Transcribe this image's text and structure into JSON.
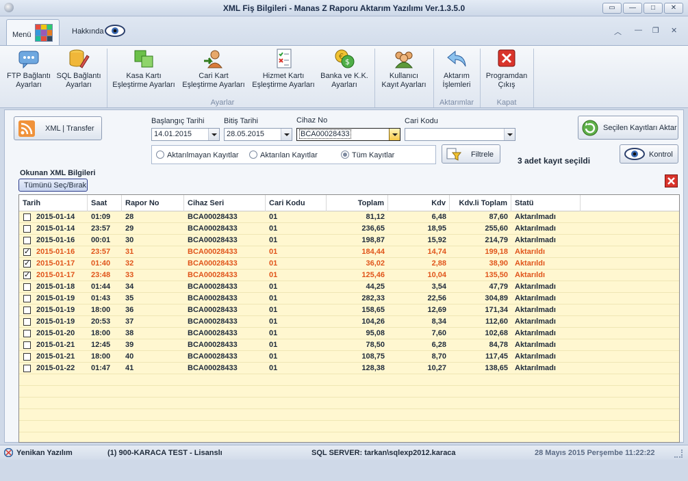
{
  "window": {
    "title": "XML Fiş Bilgileri - Manas Z Raporu Aktarım Yazılımı Ver.1.3.5.0"
  },
  "tabs": {
    "menu": "Menü",
    "about": "Hakkında"
  },
  "ribbon": {
    "buttons": [
      {
        "line1": "FTP Bağlantı",
        "line2": "Ayarları",
        "icon": "ftp-chat-icon"
      },
      {
        "line1": "SQL Bağlantı",
        "line2": "Ayarları",
        "icon": "database-pencil-icon"
      },
      {
        "line1": "Kasa Kartı",
        "line2": "Eşleştirme Ayarları",
        "icon": "green-blocks-icon"
      },
      {
        "line1": "Cari Kart",
        "line2": "Eşleştirme Ayarları",
        "icon": "user-arrow-icon"
      },
      {
        "line1": "Hizmet Kartı",
        "line2": "Eşleştirme Ayarları",
        "icon": "checklist-icon"
      },
      {
        "line1": "Banka ve K.K.",
        "line2": "Ayarları",
        "icon": "coins-icon"
      },
      {
        "line1": "Kullanıcı",
        "line2": "Kayıt Ayarları",
        "icon": "users-icon"
      },
      {
        "line1": "Aktarım",
        "line2": "İşlemleri",
        "icon": "undo-arrow-icon"
      },
      {
        "line1": "Programdan",
        "line2": "Çıkış",
        "icon": "red-x-icon"
      }
    ],
    "groups": {
      "settings": "Ayarlar",
      "transfers": "Aktarımlar",
      "close": "Kapat"
    }
  },
  "toolbar": {
    "xml_transfer": "XML | Transfer",
    "start_date_label": "Başlangıç Tarihi",
    "start_date": "14.01.2015",
    "end_date_label": "Bitiş Tarihi",
    "end_date": "28.05.2015",
    "device_label": "Cihaz No",
    "device": "BCA00028433",
    "account_label": "Cari Kodu",
    "account": "",
    "transfer_selected": "Seçilen Kayıtları Aktar",
    "filter": "Filtrele",
    "control": "Kontrol",
    "selected_info": "3 adet kayıt seçildi",
    "radio_not_sent": "Aktarılmayan Kayıtlar",
    "radio_sent": "Aktarılan Kayıtlar",
    "radio_all": "Tüm Kayıtlar",
    "radio_selected": "all"
  },
  "grid": {
    "title": "Okunan XML Bilgileri",
    "select_all": "Tümünü Seç/Bırak",
    "columns": [
      "Tarih",
      "Saat",
      "Rapor No",
      "Cihaz Seri",
      "Cari Kodu",
      "Toplam",
      "Kdv",
      "Kdv.li Toplam",
      "Statü"
    ],
    "rows": [
      {
        "checked": false,
        "date": "2015-01-14",
        "time": "01:09",
        "report": "28",
        "serial": "BCA00028433",
        "account": "01",
        "total": "81,12",
        "vat": "6,48",
        "total_vat": "87,60",
        "status": "Aktarılmadı"
      },
      {
        "checked": false,
        "date": "2015-01-14",
        "time": "23:57",
        "report": "29",
        "serial": "BCA00028433",
        "account": "01",
        "total": "236,65",
        "vat": "18,95",
        "total_vat": "255,60",
        "status": "Aktarılmadı"
      },
      {
        "checked": false,
        "date": "2015-01-16",
        "time": "00:01",
        "report": "30",
        "serial": "BCA00028433",
        "account": "01",
        "total": "198,87",
        "vat": "15,92",
        "total_vat": "214,79",
        "status": "Aktarılmadı"
      },
      {
        "checked": true,
        "date": "2015-01-16",
        "time": "23:57",
        "report": "31",
        "serial": "BCA00028433",
        "account": "01",
        "total": "184,44",
        "vat": "14,74",
        "total_vat": "199,18",
        "status": "Aktarıldı"
      },
      {
        "checked": true,
        "date": "2015-01-17",
        "time": "01:40",
        "report": "32",
        "serial": "BCA00028433",
        "account": "01",
        "total": "36,02",
        "vat": "2,88",
        "total_vat": "38,90",
        "status": "Aktarıldı"
      },
      {
        "checked": true,
        "date": "2015-01-17",
        "time": "23:48",
        "report": "33",
        "serial": "BCA00028433",
        "account": "01",
        "total": "125,46",
        "vat": "10,04",
        "total_vat": "135,50",
        "status": "Aktarıldı"
      },
      {
        "checked": false,
        "date": "2015-01-18",
        "time": "01:44",
        "report": "34",
        "serial": "BCA00028433",
        "account": "01",
        "total": "44,25",
        "vat": "3,54",
        "total_vat": "47,79",
        "status": "Aktarılmadı"
      },
      {
        "checked": false,
        "date": "2015-01-19",
        "time": "01:43",
        "report": "35",
        "serial": "BCA00028433",
        "account": "01",
        "total": "282,33",
        "vat": "22,56",
        "total_vat": "304,89",
        "status": "Aktarılmadı"
      },
      {
        "checked": false,
        "date": "2015-01-19",
        "time": "18:00",
        "report": "36",
        "serial": "BCA00028433",
        "account": "01",
        "total": "158,65",
        "vat": "12,69",
        "total_vat": "171,34",
        "status": "Aktarılmadı"
      },
      {
        "checked": false,
        "date": "2015-01-19",
        "time": "20:53",
        "report": "37",
        "serial": "BCA00028433",
        "account": "01",
        "total": "104,26",
        "vat": "8,34",
        "total_vat": "112,60",
        "status": "Aktarılmadı"
      },
      {
        "checked": false,
        "date": "2015-01-20",
        "time": "18:00",
        "report": "38",
        "serial": "BCA00028433",
        "account": "01",
        "total": "95,08",
        "vat": "7,60",
        "total_vat": "102,68",
        "status": "Aktarılmadı"
      },
      {
        "checked": false,
        "date": "2015-01-21",
        "time": "12:45",
        "report": "39",
        "serial": "BCA00028433",
        "account": "01",
        "total": "78,50",
        "vat": "6,28",
        "total_vat": "84,78",
        "status": "Aktarılmadı"
      },
      {
        "checked": false,
        "date": "2015-01-21",
        "time": "18:00",
        "report": "40",
        "serial": "BCA00028433",
        "account": "01",
        "total": "108,75",
        "vat": "8,70",
        "total_vat": "117,45",
        "status": "Aktarılmadı"
      },
      {
        "checked": false,
        "date": "2015-01-22",
        "time": "01:47",
        "report": "41",
        "serial": "BCA00028433",
        "account": "01",
        "total": "128,38",
        "vat": "10,27",
        "total_vat": "138,65",
        "status": "Aktarılmadı"
      }
    ]
  },
  "statusbar": {
    "company": "Yenikan Yazılım",
    "license": "(1) 900-KARACA TEST  - Lisanslı",
    "server": "SQL SERVER: tarkan\\sqlexp2012.karaca",
    "datetime": "28 Mayıs 2015 Perşembe 11:22:22"
  },
  "colors": {
    "sent_row": "#e0541a",
    "grid_bg": "#fff7d0",
    "accent": "#1a2b48"
  }
}
